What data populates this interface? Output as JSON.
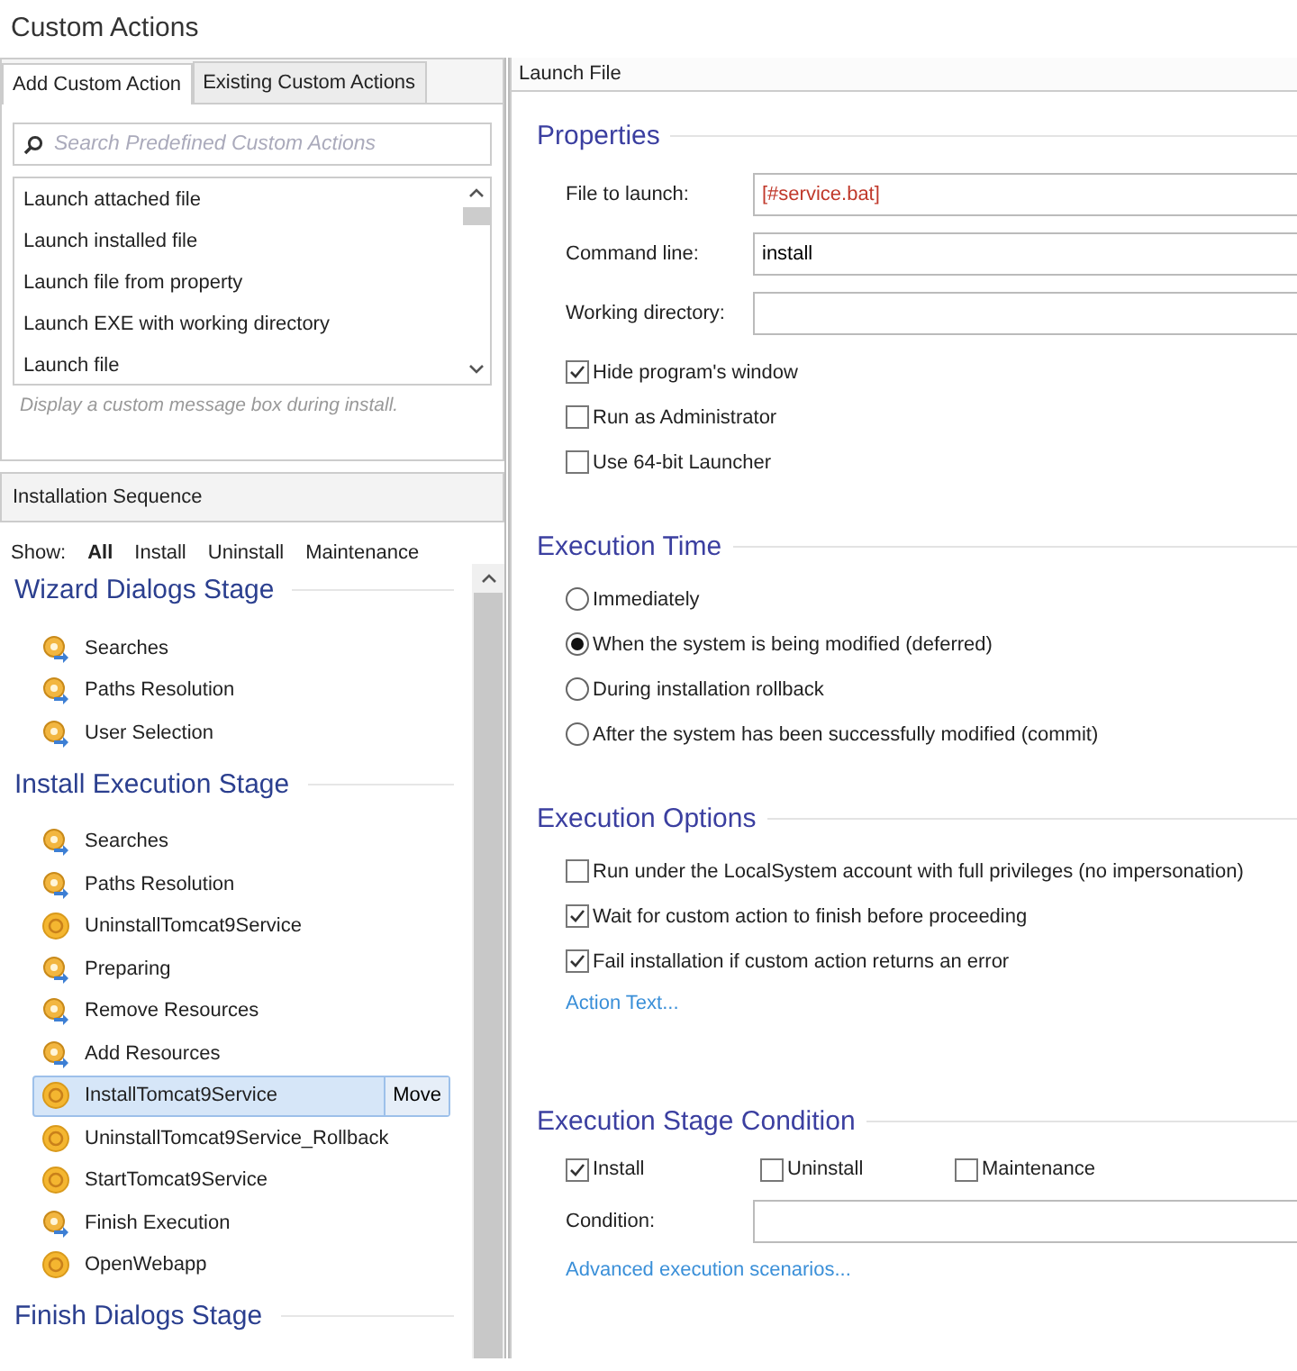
{
  "window": {
    "title": "Custom Actions"
  },
  "tabs": [
    {
      "label": "Add Custom Action",
      "selected": true
    },
    {
      "label": "Existing Custom Actions",
      "selected": false
    }
  ],
  "search": {
    "placeholder": "Search Predefined Custom Actions"
  },
  "predefined_actions": [
    "Launch attached file",
    "Launch installed file",
    "Launch file from property",
    "Launch EXE with working directory",
    "Launch file"
  ],
  "action_hint": "Display a custom message box during install.",
  "sequence": {
    "title": "Installation Sequence",
    "show_label": "Show:",
    "filters": [
      {
        "label": "All",
        "selected": true
      },
      {
        "label": "Install",
        "selected": false
      },
      {
        "label": "Uninstall",
        "selected": false
      },
      {
        "label": "Maintenance",
        "selected": false
      }
    ],
    "stages": [
      {
        "title": "Wizard Dialogs Stage",
        "items": [
          {
            "label": "Searches",
            "kind": "step",
            "selected": false
          },
          {
            "label": "Paths Resolution",
            "kind": "step",
            "selected": false
          },
          {
            "label": "User Selection",
            "kind": "step",
            "selected": false
          }
        ]
      },
      {
        "title": "Install Execution Stage",
        "items": [
          {
            "label": "Searches",
            "kind": "step",
            "selected": false
          },
          {
            "label": "Paths Resolution",
            "kind": "step",
            "selected": false
          },
          {
            "label": "UninstallTomcat9Service",
            "kind": "action",
            "selected": false
          },
          {
            "label": "Preparing",
            "kind": "step",
            "selected": false
          },
          {
            "label": "Remove Resources",
            "kind": "step",
            "selected": false
          },
          {
            "label": "Add Resources",
            "kind": "step",
            "selected": false
          },
          {
            "label": "InstallTomcat9Service",
            "kind": "action",
            "selected": true,
            "button": "Move"
          },
          {
            "label": "UninstallTomcat9Service_Rollback",
            "kind": "action",
            "selected": false
          },
          {
            "label": "StartTomcat9Service",
            "kind": "action",
            "selected": false
          },
          {
            "label": "Finish Execution",
            "kind": "step",
            "selected": false
          },
          {
            "label": "OpenWebapp",
            "kind": "action",
            "selected": false
          }
        ]
      },
      {
        "title": "Finish Dialogs Stage"
      }
    ]
  },
  "detail": {
    "title": "Launch File",
    "properties": {
      "title": "Properties",
      "fields": [
        {
          "label": "File to launch:",
          "value": "[#service.bat]",
          "kind": "reference"
        },
        {
          "label": "Command line:",
          "value": "install",
          "kind": "plain"
        },
        {
          "label": "Working directory:",
          "kind": "plain"
        }
      ],
      "options": [
        {
          "label": "Hide program's window",
          "checked": true
        },
        {
          "label": "Run as Administrator",
          "checked": false
        },
        {
          "label": "Use 64-bit Launcher",
          "checked": false
        }
      ]
    },
    "execution_time": {
      "title": "Execution Time",
      "choices": [
        {
          "label": "Immediately",
          "selected": false
        },
        {
          "label": "When the system is being modified (deferred)",
          "selected": true
        },
        {
          "label": "During installation rollback",
          "selected": false
        },
        {
          "label": "After the system has been successfully modified (commit)",
          "selected": false
        }
      ]
    },
    "execution_options": {
      "title": "Execution Options",
      "options": [
        {
          "label": "Run under the LocalSystem account with full privileges (no impersonation)",
          "checked": false
        },
        {
          "label": "Wait for custom action to finish before proceeding",
          "checked": true
        },
        {
          "label": "Fail installation if custom action returns an error",
          "checked": true
        }
      ],
      "link": "Action Text..."
    },
    "stage_condition": {
      "title": "Execution Stage Condition",
      "stages": [
        {
          "label": "Install",
          "checked": true
        },
        {
          "label": "Uninstall",
          "checked": false
        },
        {
          "label": "Maintenance",
          "checked": false
        }
      ],
      "condition_label": "Condition:",
      "link": "Advanced execution scenarios..."
    }
  }
}
